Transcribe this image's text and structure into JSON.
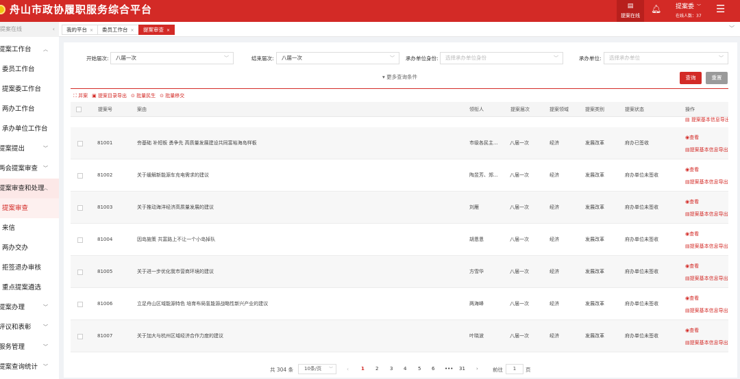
{
  "app": {
    "title": "舟山市政协履职服务综合平台"
  },
  "header": {
    "online_label": "提案在线",
    "user_name": "提案委",
    "online_count_label": "在线人数：37"
  },
  "sidebar": {
    "search_placeholder": "提案在线",
    "items": [
      {
        "label": "提案工作台"
      },
      {
        "label": "委员工作台"
      },
      {
        "label": "提案委工作台"
      },
      {
        "label": "两办工作台"
      },
      {
        "label": "承办单位工作台"
      },
      {
        "label": "提案提出"
      },
      {
        "label": "两会提案审查"
      },
      {
        "label": "提案审查和处理"
      },
      {
        "label": "提案审查"
      },
      {
        "label": "来信"
      },
      {
        "label": "两办交办"
      },
      {
        "label": "拒签退办审核"
      },
      {
        "label": "重点提案遴选"
      },
      {
        "label": "提案办理"
      },
      {
        "label": "评议和表彰"
      },
      {
        "label": "服务管理"
      },
      {
        "label": "提案查询统计"
      }
    ]
  },
  "tabs": [
    {
      "label": "我的平台"
    },
    {
      "label": "委员工作台"
    },
    {
      "label": "提案审查"
    }
  ],
  "filters": {
    "start_session_label": "开始届次:",
    "start_session_value": "八届一次",
    "end_session_label": "结束届次:",
    "end_session_value": "八届一次",
    "unit_identity_label": "承办单位身份:",
    "unit_identity_placeholder": "选择承办单位身份",
    "unit_label": "承办单位:",
    "unit_placeholder": "选择承办单位",
    "more_label": "▾ 更多查询条件",
    "search_button": "查询",
    "reset_button": "重置"
  },
  "actions": [
    {
      "icon": "merge-icon",
      "label": "并案"
    },
    {
      "icon": "export-icon",
      "label": "提案目录导出"
    },
    {
      "icon": "batch-icon",
      "label": "批量民生"
    },
    {
      "icon": "transfer-icon",
      "label": "批量移交"
    }
  ],
  "table": {
    "columns": [
      "提案号",
      "案由",
      "领衔人",
      "提案届次",
      "提案领域",
      "提案类别",
      "提案状态",
      "操作"
    ],
    "op_view": "查看",
    "op_export": "提案基本信息导出",
    "rows": [
      {
        "no": "81001",
        "title": "夯基础 补短板 勇争先 高质量发展建设共同富裕海岛样板",
        "lead": "市级各民主...",
        "session": "八届一次",
        "field": "经济",
        "category": "发展改革",
        "status": "府办已签收"
      },
      {
        "no": "81002",
        "title": "关于缓解新能源车充电需求的建议",
        "lead": "陶昱芳、郑...",
        "session": "八届一次",
        "field": "经济",
        "category": "发展改革",
        "status": "府办单位未签收"
      },
      {
        "no": "81003",
        "title": "关于推动海洋经济高质量发展的建议",
        "lead": "刘雁",
        "session": "八届一次",
        "field": "经济",
        "category": "发展改革",
        "status": "府办单位未签收"
      },
      {
        "no": "81004",
        "title": "因岛施策 共富路上不让一个小岛掉队",
        "lead": "胡恩恩",
        "session": "八届一次",
        "field": "经济",
        "category": "发展改革",
        "status": "府办单位未签收"
      },
      {
        "no": "81005",
        "title": "关于进一步优化我市营商环境的建议",
        "lead": "方雪华",
        "session": "八届一次",
        "field": "经济",
        "category": "发展改革",
        "status": "府办单位未签收"
      },
      {
        "no": "81006",
        "title": "立足舟山区域能源特色 培育布局氢能源战略性新兴产业的建议",
        "lead": "两海峰",
        "session": "八届一次",
        "field": "经济",
        "category": "发展改革",
        "status": "府办单位未签收"
      },
      {
        "no": "81007",
        "title": "关于加大与杭州区域经济合作力度的建议",
        "lead": "叶晓波",
        "session": "八届一次",
        "field": "经济",
        "category": "发展改革",
        "status": "府办单位未签收"
      }
    ]
  },
  "pagination": {
    "total": "共 304 条",
    "page_size": "10条/页",
    "pages": [
      "1",
      "2",
      "3",
      "4",
      "5",
      "6",
      "•••",
      "31"
    ],
    "goto_label": "前往",
    "goto_value": "1",
    "unit": "页"
  },
  "colors": {
    "brand": "#d32a26",
    "reset": "#9a9a9a"
  }
}
